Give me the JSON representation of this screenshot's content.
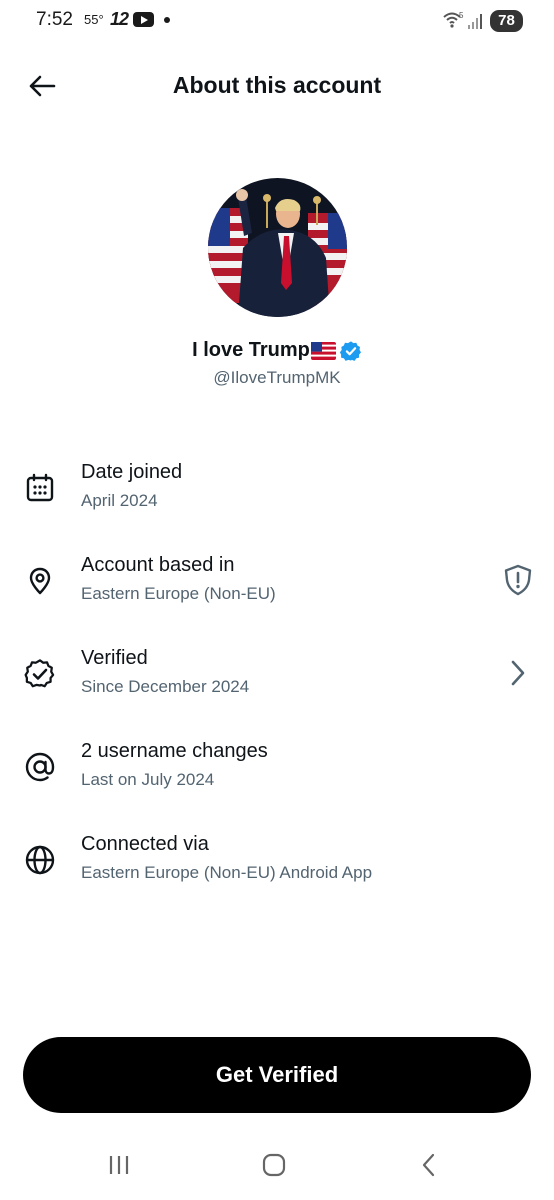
{
  "status_bar": {
    "time": "7:52",
    "temperature": "55°",
    "app_badge": "12",
    "battery": "78",
    "wifi_label": "5"
  },
  "header": {
    "title": "About this account"
  },
  "profile": {
    "display_name": "I love Trump",
    "handle": "@IloveTrumpMK",
    "verified": true
  },
  "info_rows": [
    {
      "title": "Date joined",
      "subtitle": "April 2024",
      "icon": "calendar-icon"
    },
    {
      "title": "Account based in",
      "subtitle": "Eastern Europe (Non-EU)",
      "icon": "location-pin-icon",
      "trailing": "shield-alert-icon"
    },
    {
      "title": "Verified",
      "subtitle": "Since December 2024",
      "icon": "verified-badge-icon",
      "trailing": "chevron-right-icon"
    },
    {
      "title": "2 username changes",
      "subtitle": "Last on July 2024",
      "icon": "at-sign-icon"
    },
    {
      "title": "Connected via",
      "subtitle": "Eastern Europe (Non-EU) Android App",
      "icon": "globe-icon"
    }
  ],
  "cta": {
    "label": "Get Verified"
  },
  "colors": {
    "primary_text": "#0f1419",
    "secondary_text": "#536471",
    "verified_blue": "#1d9bf0",
    "button_bg": "#000000"
  }
}
